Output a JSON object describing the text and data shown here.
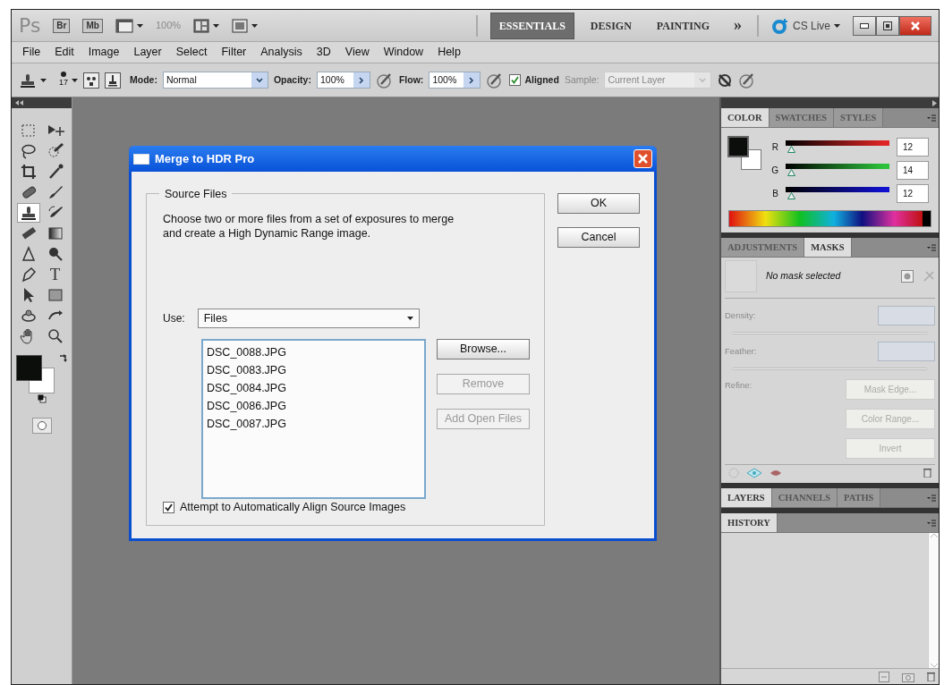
{
  "app_bar": {
    "logo": "Ps",
    "buttons": [
      "Br",
      "Mb"
    ],
    "zoom": {
      "value": "100%",
      "disabled": true
    },
    "workspaces": [
      {
        "label": "ESSENTIALS",
        "selected": true
      },
      {
        "label": "DESIGN",
        "selected": false
      },
      {
        "label": "PAINTING",
        "selected": false
      }
    ],
    "more": "»",
    "cs_live": "CS Live"
  },
  "menu": [
    "File",
    "Edit",
    "Image",
    "Layer",
    "Select",
    "Filter",
    "Analysis",
    "3D",
    "View",
    "Window",
    "Help"
  ],
  "options_bar": {
    "brush_size": "17",
    "mode": {
      "label": "Mode:",
      "value": "Normal"
    },
    "opacity": {
      "label": "Opacity:",
      "value": "100%"
    },
    "flow": {
      "label": "Flow:",
      "value": "100%"
    },
    "aligned": {
      "label": "Aligned",
      "checked": true
    },
    "sample": {
      "label": "Sample:",
      "value": "Current Layer",
      "disabled": true
    }
  },
  "tools": {
    "items": [
      {
        "kind": "marquee",
        "selected": false
      },
      {
        "kind": "move",
        "selected": false
      },
      {
        "kind": "lasso",
        "selected": false
      },
      {
        "kind": "quick-select",
        "selected": false
      },
      {
        "kind": "crop",
        "selected": false
      },
      {
        "kind": "eyedropper",
        "selected": false
      },
      {
        "kind": "healing",
        "selected": false
      },
      {
        "kind": "brush",
        "selected": false
      },
      {
        "kind": "stamp",
        "selected": true
      },
      {
        "kind": "history-brush",
        "selected": false
      },
      {
        "kind": "eraser",
        "selected": false
      },
      {
        "kind": "gradient",
        "selected": false
      },
      {
        "kind": "blur",
        "selected": false
      },
      {
        "kind": "dodge",
        "selected": false
      },
      {
        "kind": "pen",
        "selected": false
      },
      {
        "kind": "type",
        "glyph": "T",
        "selected": false
      },
      {
        "kind": "path-select",
        "selected": false
      },
      {
        "kind": "shape",
        "selected": false
      },
      {
        "kind": "rotate-3d",
        "selected": false
      },
      {
        "kind": "orbit-3d",
        "selected": false
      },
      {
        "kind": "hand",
        "selected": false
      },
      {
        "kind": "zoom",
        "selected": false
      }
    ]
  },
  "dialog": {
    "title": "Merge to HDR Pro",
    "group_title": "Source Files",
    "description": "Choose two or more files from a set of exposures to merge and create a High Dynamic Range image.",
    "use": {
      "label": "Use:",
      "value": "Files"
    },
    "files": [
      "DSC_0088.JPG",
      "DSC_0083.JPG",
      "DSC_0084.JPG",
      "DSC_0086.JPG",
      "DSC_0087.JPG"
    ],
    "list_buttons": [
      {
        "label": "Browse...",
        "disabled": false
      },
      {
        "label": "Remove",
        "disabled": true
      },
      {
        "label": "Add Open Files",
        "disabled": true
      }
    ],
    "align": {
      "label": "Attempt to Automatically Align Source Images",
      "checked": true
    },
    "buttons": [
      "OK",
      "Cancel"
    ]
  },
  "color_panel": {
    "tabs": [
      {
        "label": "COLOR",
        "selected": true
      },
      {
        "label": "SWATCHES",
        "selected": false
      },
      {
        "label": "STYLES",
        "selected": false
      }
    ],
    "channels": [
      {
        "name": "R",
        "color": "#e02424",
        "level": 0.05,
        "value": "12"
      },
      {
        "name": "G",
        "color": "#2cc23c",
        "level": 0.05,
        "value": "14"
      },
      {
        "name": "B",
        "color": "#1010d0",
        "level": 0.05,
        "value": "12"
      }
    ]
  },
  "masks_panel": {
    "tabs": [
      {
        "label": "ADJUSTMENTS",
        "selected": false
      },
      {
        "label": "MASKS",
        "selected": true
      }
    ],
    "status": "No mask selected",
    "density": {
      "label": "Density:",
      "disabled": true
    },
    "feather": {
      "label": "Feather:",
      "disabled": true
    },
    "refine_label": "Refine:",
    "buttons": [
      {
        "label": "Mask Edge...",
        "disabled": true
      },
      {
        "label": "Color Range...",
        "disabled": true
      },
      {
        "label": "Invert",
        "disabled": true
      }
    ]
  },
  "layers_panel": {
    "tabs": [
      {
        "label": "LAYERS",
        "selected": true
      },
      {
        "label": "CHANNELS",
        "selected": false
      },
      {
        "label": "PATHS",
        "selected": false
      }
    ]
  },
  "history_panel": {
    "tabs": [
      {
        "label": "HISTORY",
        "selected": true
      }
    ]
  }
}
